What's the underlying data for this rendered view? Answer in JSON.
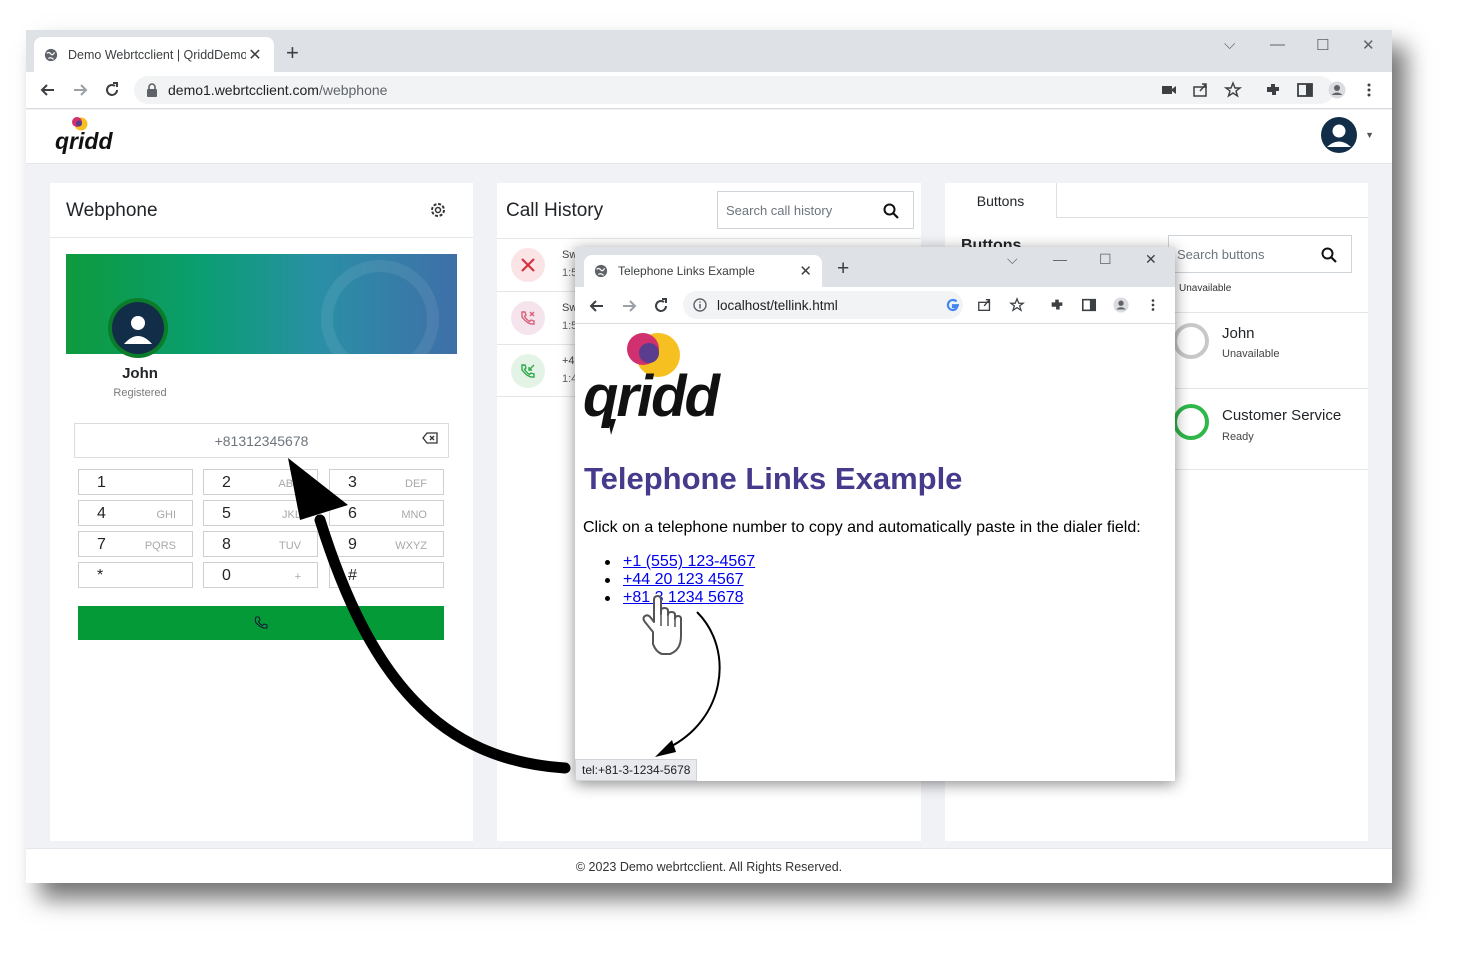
{
  "browser": {
    "tab_title": "Demo Webrtcclient | QriddDemo",
    "url_host": "demo1.webrtcclient.com",
    "url_path": "/webphone"
  },
  "app": {
    "logo_text": "qridd"
  },
  "webphone": {
    "title": "Webphone",
    "user_name": "John",
    "user_status": "Registered",
    "dial_value": "+81312345678",
    "keys": [
      {
        "digit": "1",
        "letters": ""
      },
      {
        "digit": "2",
        "letters": "ABC"
      },
      {
        "digit": "3",
        "letters": "DEF"
      },
      {
        "digit": "4",
        "letters": "GHI"
      },
      {
        "digit": "5",
        "letters": "JKL"
      },
      {
        "digit": "6",
        "letters": "MNO"
      },
      {
        "digit": "7",
        "letters": "PQRS"
      },
      {
        "digit": "8",
        "letters": "TUV"
      },
      {
        "digit": "9",
        "letters": "WXYZ"
      },
      {
        "digit": "*",
        "letters": ""
      },
      {
        "digit": "0",
        "letters": "+"
      },
      {
        "digit": "#",
        "letters": ""
      }
    ]
  },
  "history": {
    "title": "Call History",
    "search_placeholder": "Search call history",
    "rows": [
      {
        "line1": "Sw",
        "line2": "1:5",
        "kind": "missed"
      },
      {
        "line1": "Sw",
        "line2": "1:5",
        "kind": "rejected"
      },
      {
        "line1": "+4",
        "line2": "1:4",
        "kind": "incoming"
      }
    ]
  },
  "buttons_panel": {
    "tab_label": "Buttons",
    "heading": "Buttons",
    "search_placeholder": "Search buttons",
    "top_status": "Unavailable",
    "items": [
      {
        "name": "John",
        "state": "Unavailable",
        "ring_color": "#c8c8c8"
      },
      {
        "name": "Customer Service",
        "state": "Ready",
        "ring_color": "#2fb84a"
      }
    ]
  },
  "footer": {
    "text": "© 2023 Demo webrtcclient. All Rights Reserved."
  },
  "popup": {
    "tab_title": "Telephone Links Example",
    "url": "localhost/tellink.html",
    "logo_text": "qridd",
    "heading": "Telephone Links Example",
    "description": "Click on a telephone number to copy and automatically paste in the dialer field:",
    "links": [
      "+1 (555) 123-4567",
      "+44 20 123 4567",
      "+81 3 1234 5678"
    ],
    "status_url": "tel:+81-3-1234-5678"
  },
  "colors": {
    "call_green": "#049a38",
    "heading_purple": "#453a8c",
    "link_blue": "#0000ee",
    "navy": "#122d48"
  }
}
